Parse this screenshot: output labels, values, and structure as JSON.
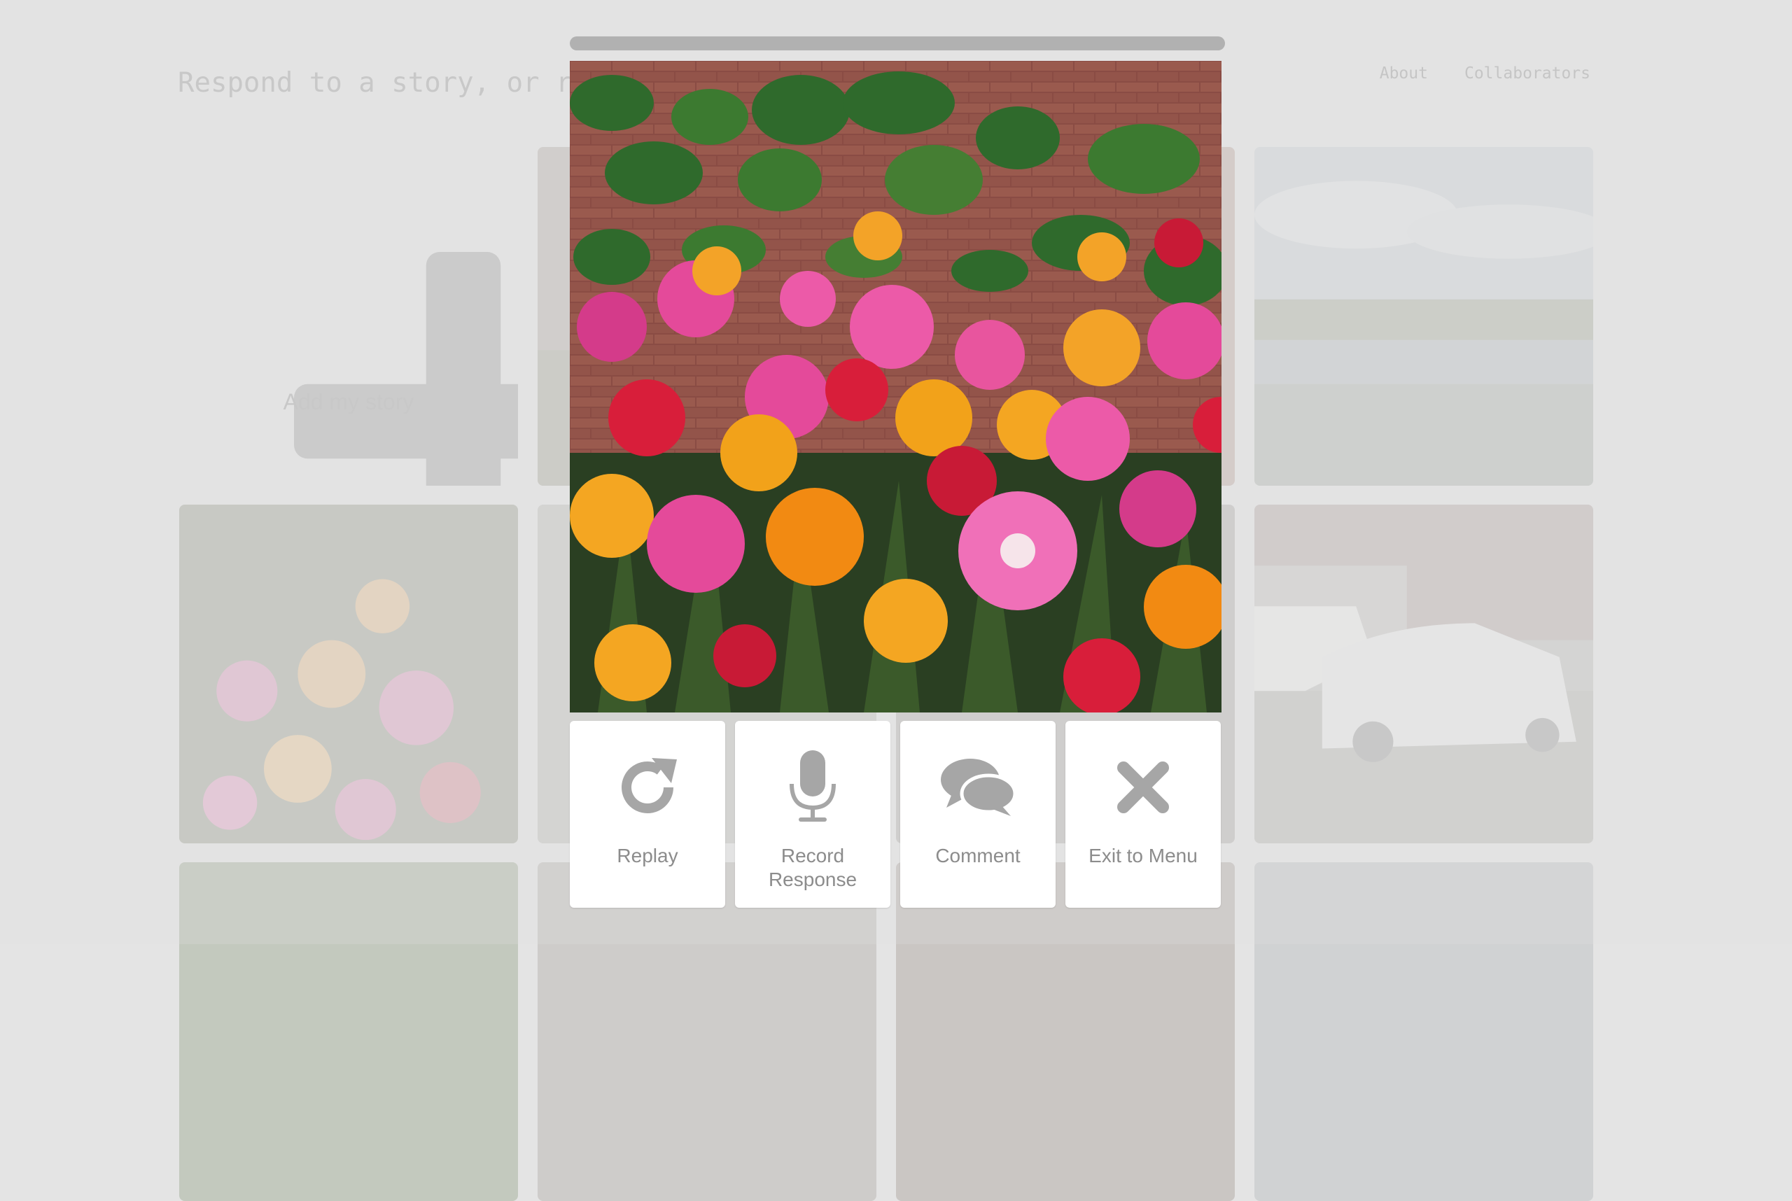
{
  "background": {
    "heading": "Respond to a story, or re",
    "nav": [
      "About",
      "Collaborators"
    ],
    "add_tile_label": "Add my story"
  },
  "modal": {
    "actions": [
      {
        "label": "Replay",
        "icon": "replay-icon"
      },
      {
        "label": "Record Response",
        "icon": "microphone-icon"
      },
      {
        "label": "Comment",
        "icon": "comment-icon"
      },
      {
        "label": "Exit to Menu",
        "icon": "close-icon"
      }
    ]
  },
  "colors": {
    "icon_gray": "#a6a6a6",
    "label_gray": "#8c8c8c",
    "progress_bar": "#b1b1b1",
    "page_bg": "#e4e4e4"
  }
}
